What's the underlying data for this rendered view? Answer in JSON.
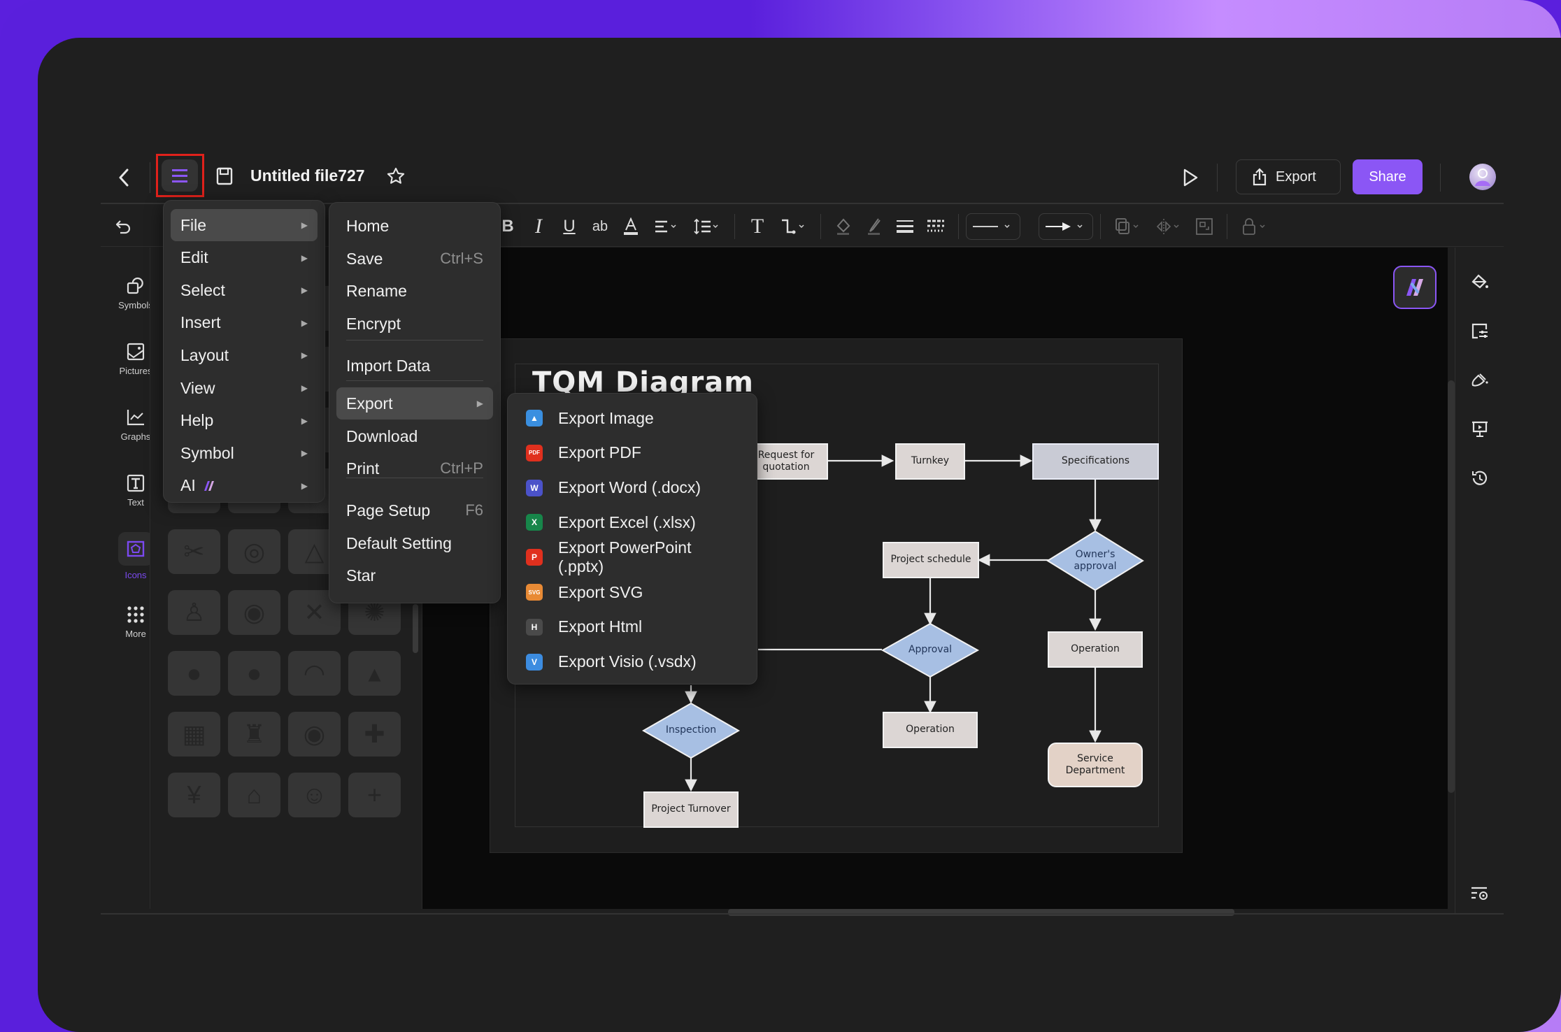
{
  "header": {
    "file_title": "Untitled file727",
    "export_label": "Export",
    "share_label": "Share"
  },
  "colors": {
    "accent": "#8b56f5",
    "highlight_box": "#e0211b",
    "diamond_fill": "#a7bfe3",
    "rect_fill": "#dcd6d4"
  },
  "toolbar": {
    "items": [
      "undo-icon",
      "redo-icon",
      "bold-icon",
      "italic-icon",
      "underline-icon",
      "highlight-icon",
      "font-color-icon",
      "align-icon",
      "line-spacing-icon",
      "text-icon",
      "connector-icon",
      "fill-icon",
      "line-color-icon",
      "line-weight-icon",
      "line-dash-icon",
      "line-style-dropdown",
      "arrow-style-dropdown",
      "arrange-icon",
      "flip-icon",
      "group-icon",
      "lock-icon"
    ],
    "bold": "B",
    "highlight": "ab"
  },
  "left_sidebar": {
    "items": [
      {
        "label": "Symbols",
        "icon": "symbols-icon"
      },
      {
        "label": "Pictures",
        "icon": "pictures-icon"
      },
      {
        "label": "Graphs",
        "icon": "graphs-icon"
      },
      {
        "label": "Text",
        "icon": "text-icon"
      },
      {
        "label": "Icons",
        "icon": "icons-icon",
        "active": true
      },
      {
        "label": "More",
        "icon": "more-icon"
      }
    ]
  },
  "main_menu": {
    "items": [
      {
        "label": "File",
        "highlighted": true
      },
      {
        "label": "Edit"
      },
      {
        "label": "Select"
      },
      {
        "label": "Insert"
      },
      {
        "label": "Layout"
      },
      {
        "label": "View"
      },
      {
        "label": "Help"
      },
      {
        "label": "Symbol"
      },
      {
        "label": "AI"
      }
    ]
  },
  "file_menu": {
    "items": [
      {
        "label": "Home",
        "shortcut": ""
      },
      {
        "label": "Save",
        "shortcut": "Ctrl+S"
      },
      {
        "label": "Rename",
        "shortcut": ""
      },
      {
        "label": "Encrypt",
        "shortcut": ""
      },
      {
        "label": "Import Data",
        "shortcut": ""
      },
      {
        "label": "Export",
        "shortcut": "",
        "highlighted": true
      },
      {
        "label": "Download",
        "shortcut": ""
      },
      {
        "label": "Print",
        "shortcut": "Ctrl+P"
      },
      {
        "label": "Page Setup",
        "shortcut": "F6"
      },
      {
        "label": "Default Setting",
        "shortcut": ""
      },
      {
        "label": "Star",
        "shortcut": ""
      }
    ]
  },
  "export_menu": {
    "items": [
      {
        "label": "Export Image",
        "icon": "image-file-icon",
        "glyph": "▲",
        "color": "#3a8fe0"
      },
      {
        "label": "Export PDF",
        "icon": "pdf-file-icon",
        "glyph": "PDF",
        "color": "#e0301e"
      },
      {
        "label": "Export Word (.docx)",
        "icon": "word-file-icon",
        "glyph": "W",
        "color": "#4b52c9"
      },
      {
        "label": "Export Excel (.xlsx)",
        "icon": "excel-file-icon",
        "glyph": "X",
        "color": "#17864a"
      },
      {
        "label": "Export PowerPoint (.pptx)",
        "icon": "powerpoint-file-icon",
        "glyph": "P",
        "color": "#e0301e"
      },
      {
        "label": "Export SVG",
        "icon": "svg-file-icon",
        "glyph": "SVG",
        "color": "#e88a35"
      },
      {
        "label": "Export Html",
        "icon": "html-file-icon",
        "glyph": "H",
        "color": "#4a4a4a"
      },
      {
        "label": "Export Visio (.vsdx)",
        "icon": "visio-file-icon",
        "glyph": "V",
        "color": "#3c8ce0"
      }
    ]
  },
  "diagram": {
    "title": "TQM Diagram",
    "nodes": {
      "request": "Request for quotation",
      "turnkey": "Turnkey",
      "specifications": "Specifications",
      "owners_approval": "Owner's approval",
      "project_schedule": "Project schedule",
      "approval": "Approval",
      "operation_right": "Operation",
      "operation_mid": "Operation",
      "inspection": "Inspection",
      "service_department": "Service Department",
      "project_turnover": "Project Turnover"
    }
  }
}
